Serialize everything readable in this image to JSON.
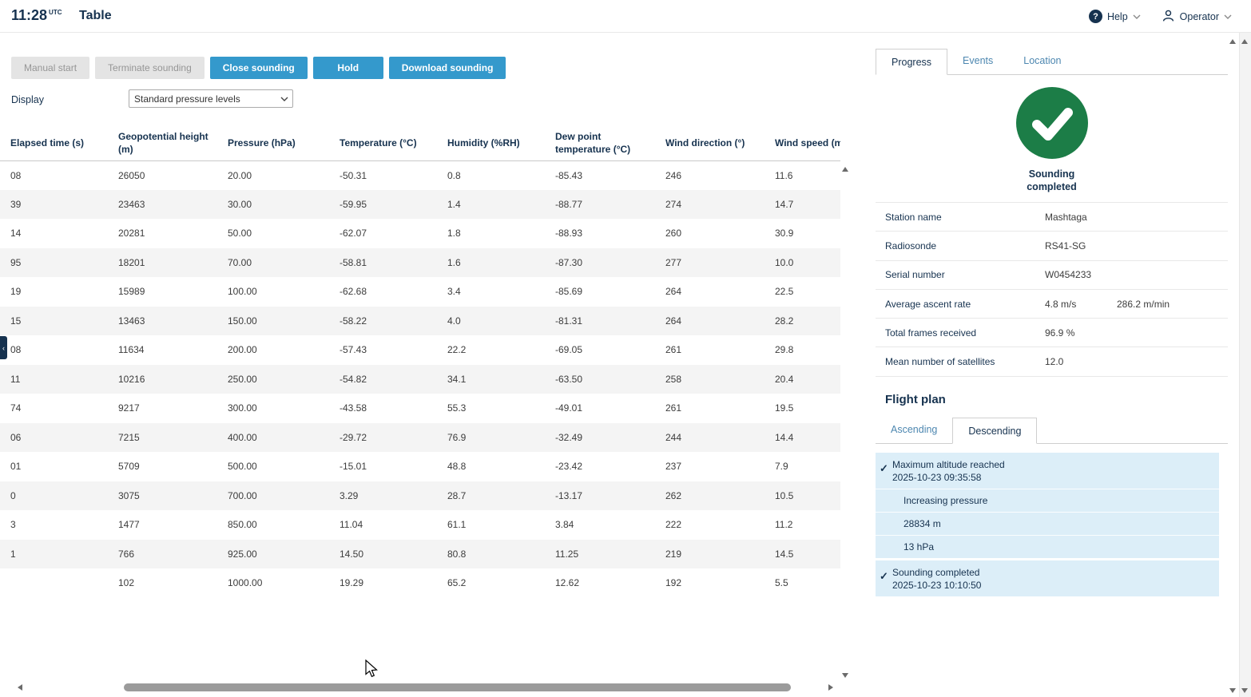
{
  "header": {
    "time": "11:28",
    "time_suffix": "UTC",
    "title": "Table",
    "help_label": "Help",
    "user_label": "Operator"
  },
  "icons": {
    "help_q": "?",
    "check": "✓",
    "collapse": "‹"
  },
  "toolbar": {
    "buttons": [
      {
        "label": "Manual start",
        "state": "disabled"
      },
      {
        "label": "Terminate sounding",
        "state": "disabled"
      },
      {
        "label": "Close sounding",
        "state": "primary"
      },
      {
        "label": "Hold",
        "state": "primary"
      },
      {
        "label": "Download sounding",
        "state": "primary"
      }
    ],
    "display_label": "Display",
    "display_select_value": "Standard pressure levels"
  },
  "table": {
    "columns": [
      "Elapsed time (s)",
      "Geopotential height (m)",
      "Pressure (hPa)",
      "Temperature (°C)",
      "Humidity (%RH)",
      "Dew point temperature (°C)",
      "Wind direction (°)",
      "Wind speed (m/s)"
    ],
    "rows": [
      [
        "08",
        "26050",
        "20.00",
        "-50.31",
        "0.8",
        "-85.43",
        "246",
        "11.6"
      ],
      [
        "39",
        "23463",
        "30.00",
        "-59.95",
        "1.4",
        "-88.77",
        "274",
        "14.7"
      ],
      [
        "14",
        "20281",
        "50.00",
        "-62.07",
        "1.8",
        "-88.93",
        "260",
        "30.9"
      ],
      [
        "95",
        "18201",
        "70.00",
        "-58.81",
        "1.6",
        "-87.30",
        "277",
        "10.0"
      ],
      [
        "19",
        "15989",
        "100.00",
        "-62.68",
        "3.4",
        "-85.69",
        "264",
        "22.5"
      ],
      [
        "15",
        "13463",
        "150.00",
        "-58.22",
        "4.0",
        "-81.31",
        "264",
        "28.2"
      ],
      [
        "08",
        "11634",
        "200.00",
        "-57.43",
        "22.2",
        "-69.05",
        "261",
        "29.8"
      ],
      [
        "11",
        "10216",
        "250.00",
        "-54.82",
        "34.1",
        "-63.50",
        "258",
        "20.4"
      ],
      [
        "74",
        "9217",
        "300.00",
        "-43.58",
        "55.3",
        "-49.01",
        "261",
        "19.5"
      ],
      [
        "06",
        "7215",
        "400.00",
        "-29.72",
        "76.9",
        "-32.49",
        "244",
        "14.4"
      ],
      [
        "01",
        "5709",
        "500.00",
        "-15.01",
        "48.8",
        "-23.42",
        "237",
        "7.9"
      ],
      [
        "0",
        "3075",
        "700.00",
        "3.29",
        "28.7",
        "-13.17",
        "262",
        "10.5"
      ],
      [
        "3",
        "1477",
        "850.00",
        "11.04",
        "61.1",
        "3.84",
        "222",
        "11.2"
      ],
      [
        "1",
        "766",
        "925.00",
        "14.50",
        "80.8",
        "11.25",
        "219",
        "14.5"
      ],
      [
        "",
        "102",
        "1000.00",
        "19.29",
        "65.2",
        "12.62",
        "192",
        "5.5"
      ]
    ]
  },
  "right_panel": {
    "tabs": [
      {
        "label": "Progress",
        "active": true
      },
      {
        "label": "Events",
        "active": false
      },
      {
        "label": "Location",
        "active": false
      }
    ],
    "status_text": "Sounding completed",
    "info": [
      {
        "label": "Station name",
        "value": "Mashtaga",
        "value2": ""
      },
      {
        "label": "Radiosonde",
        "value": "RS41-SG",
        "value2": ""
      },
      {
        "label": "Serial number",
        "value": "W0454233",
        "value2": ""
      },
      {
        "label": "Average ascent rate",
        "value": "4.8 m/s",
        "value2": "286.2 m/min"
      },
      {
        "label": "Total frames received",
        "value": "96.9 %",
        "value2": ""
      },
      {
        "label": "Mean number of satellites",
        "value": "12.0",
        "value2": ""
      }
    ],
    "flight_plan": {
      "title": "Flight plan",
      "tabs": [
        {
          "label": "Ascending",
          "active": false
        },
        {
          "label": "Descending",
          "active": true
        }
      ],
      "events": [
        {
          "title": "Maximum altitude reached",
          "timestamp": "2025-10-23 09:35:58",
          "checked": true,
          "details": [
            "Increasing pressure",
            "28834 m",
            "13 hPa"
          ]
        },
        {
          "title": "Sounding completed",
          "timestamp": "2025-10-23 10:10:50",
          "checked": true,
          "details": []
        }
      ]
    }
  },
  "colors": {
    "accent_blue": "#3499cc",
    "navy": "#16324f",
    "success_green": "#1c7d47",
    "event_bg": "#dceef8"
  }
}
